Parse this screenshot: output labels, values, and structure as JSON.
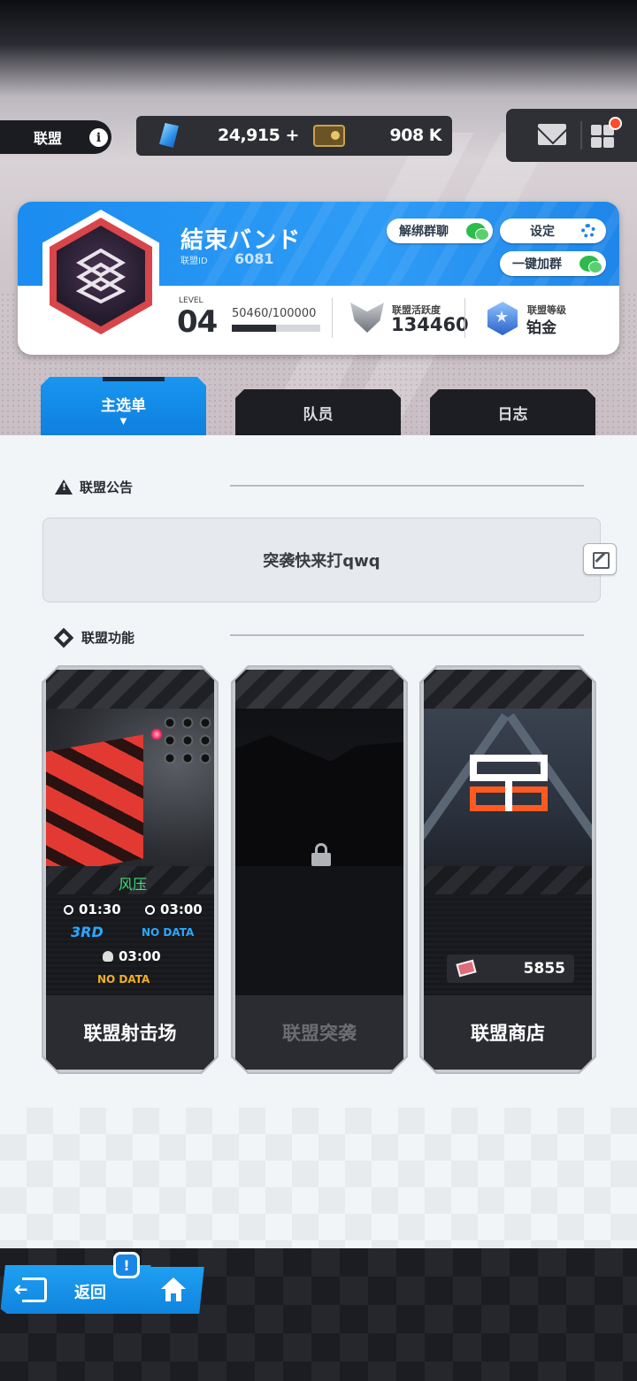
{
  "header": {
    "section_label": "联盟",
    "info_symbol": "i",
    "gems": "24,915",
    "gems_add": "+",
    "credits": "908 K"
  },
  "guild": {
    "name": "結束バンド",
    "id_label": "联盟ID",
    "id": "6081",
    "unbind_chat_label": "解绑群聊",
    "settings_label": "设定",
    "join_group_label": "一键加群",
    "level_label": "LEVEL",
    "level": "04",
    "exp_text": "50460/100000",
    "exp_fraction": 0.5046,
    "activity_label": "联盟活跃度",
    "activity": "134460",
    "rank_label": "联盟等级",
    "rank": "铂金"
  },
  "tabs": [
    {
      "label": "主选单",
      "active": true
    },
    {
      "label": "队员",
      "active": false
    },
    {
      "label": "日志",
      "active": false
    }
  ],
  "tab_caret": "▼",
  "notice": {
    "title": "联盟公告",
    "text": "突袭快来打qwq"
  },
  "features": {
    "title": "联盟功能",
    "cards": [
      {
        "name": "联盟射击场",
        "mode": "风压",
        "time_left": "01:30",
        "time_right": "03:00",
        "rank": "3RD",
        "rank_right": "NO DATA",
        "boss_time": "03:00",
        "boss_status": "NO DATA"
      },
      {
        "name": "联盟突袭",
        "locked": true
      },
      {
        "name": "联盟商店",
        "coins": "5855"
      }
    ]
  },
  "bottom": {
    "back_label": "返回",
    "alert_symbol": "!"
  },
  "colors": {
    "accent_blue": "#1b8cf0",
    "mode_green": "#3fe07a",
    "rank_blue": "#2aa8ff",
    "status_yellow": "#f0b020",
    "shop_orange": "#ff5a1f",
    "notif_red": "#ff4a2b"
  }
}
